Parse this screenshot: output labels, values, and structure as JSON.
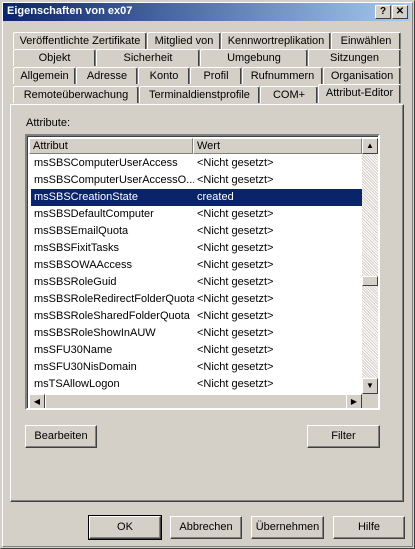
{
  "window": {
    "title": "Eigenschaften von ex07",
    "help_glyph": "?",
    "close_glyph": "✕"
  },
  "tabs": {
    "row1": [
      "Veröffentlichte Zertifikate",
      "Mitglied von",
      "Kennwortreplikation",
      "Einwählen"
    ],
    "row2": [
      "Objekt",
      "Sicherheit",
      "Umgebung",
      "Sitzungen"
    ],
    "row3": [
      "Allgemein",
      "Adresse",
      "Konto",
      "Profil",
      "Rufnummern",
      "Organisation"
    ],
    "row4": [
      "Remoteüberwachung",
      "Terminaldienstprofile",
      "COM+",
      "Attribut-Editor"
    ],
    "active": "Attribut-Editor"
  },
  "attributes": {
    "label": "Attribute:",
    "columns": [
      "Attribut",
      "Wert"
    ],
    "rows": [
      {
        "name": "msSBSComputerUserAccess",
        "value": "<Nicht gesetzt>"
      },
      {
        "name": "msSBSComputerUserAccessO...",
        "value": "<Nicht gesetzt>"
      },
      {
        "name": "msSBSCreationState",
        "value": "created"
      },
      {
        "name": "msSBSDefaultComputer",
        "value": "<Nicht gesetzt>"
      },
      {
        "name": "msSBSEmailQuota",
        "value": "<Nicht gesetzt>"
      },
      {
        "name": "msSBSFixitTasks",
        "value": "<Nicht gesetzt>"
      },
      {
        "name": "msSBSOWAAccess",
        "value": "<Nicht gesetzt>"
      },
      {
        "name": "msSBSRoleGuid",
        "value": "<Nicht gesetzt>"
      },
      {
        "name": "msSBSRoleRedirectFolderQuota",
        "value": "<Nicht gesetzt>"
      },
      {
        "name": "msSBSRoleSharedFolderQuota",
        "value": "<Nicht gesetzt>"
      },
      {
        "name": "msSBSRoleShowInAUW",
        "value": "<Nicht gesetzt>"
      },
      {
        "name": "msSFU30Name",
        "value": "<Nicht gesetzt>"
      },
      {
        "name": "msSFU30NisDomain",
        "value": "<Nicht gesetzt>"
      },
      {
        "name": "msTSAllowLogon",
        "value": "<Nicht gesetzt>"
      }
    ],
    "selected": "msSBSCreationState"
  },
  "buttons": {
    "edit": "Bearbeiten",
    "filter": "Filter",
    "ok": "OK",
    "cancel": "Abbrechen",
    "apply": "Übernehmen",
    "help": "Hilfe"
  }
}
